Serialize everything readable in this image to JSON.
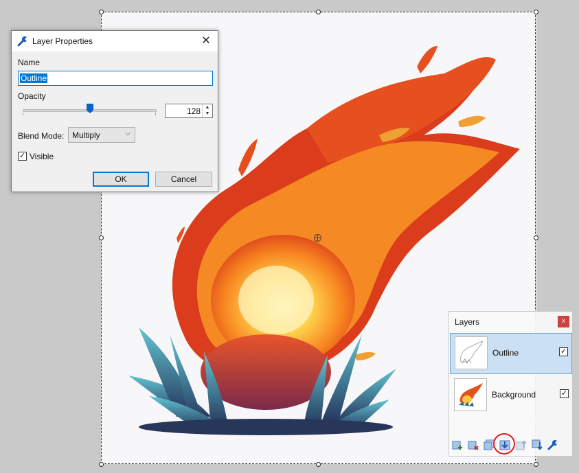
{
  "dialog": {
    "title": "Layer Properties",
    "close_symbol": "✕",
    "name_label": "Name",
    "name_value": "Outline",
    "opacity_label": "Opacity",
    "opacity_value": "128",
    "opacity_fraction": 0.5,
    "blend_label": "Blend Mode:",
    "blend_value": "Multiply",
    "visible_label": "Visible",
    "visible_checked": true,
    "ok_label": "OK",
    "cancel_label": "Cancel"
  },
  "layers_panel": {
    "title": "Layers",
    "close_symbol": "x",
    "layers": [
      {
        "name": "Outline",
        "visible": true,
        "selected": true
      },
      {
        "name": "Background",
        "visible": true,
        "selected": false
      }
    ],
    "toolbar": [
      "add-layer-icon",
      "delete-layer-icon",
      "duplicate-layer-icon",
      "merge-layer-down-icon",
      "move-layer-up-icon",
      "move-layer-down-icon",
      "layer-properties-icon"
    ],
    "highlighted_tool": "merge-layer-down-icon"
  },
  "colors": {
    "accent": "#0078d7",
    "annotation": "#e21a1a",
    "selected_row": "#cce0f4"
  }
}
